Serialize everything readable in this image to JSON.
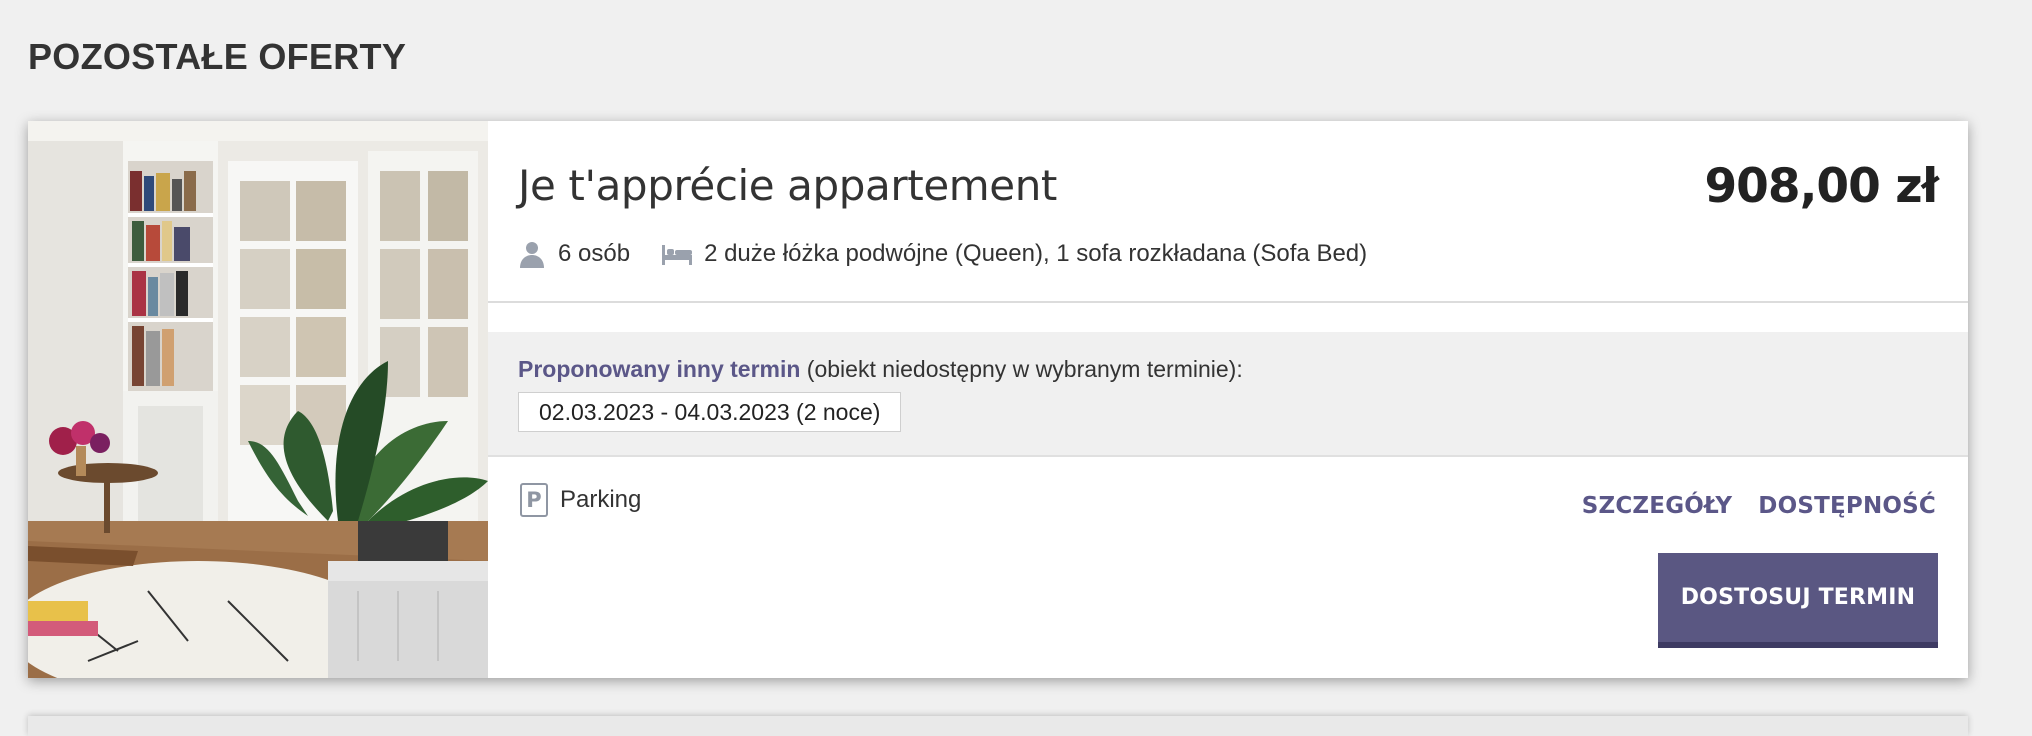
{
  "section": {
    "title": "POZOSTAŁE OFERTY"
  },
  "offer": {
    "title": "Je t'apprécie appartement",
    "price": "908,00 zł",
    "guests": "6 osób",
    "beds": "2 duże łóżka podwójne (Queen), 1 sofa rozkładana (Sofa Bed)",
    "guests_icon": "person-icon",
    "beds_icon": "bed-icon",
    "alternative": {
      "label_accent": "Proponowany inny termin",
      "label_rest": " (obiekt niedostępny w wybranym terminie):",
      "dates": "02.03.2023 - 04.03.2023 (2 noce)"
    },
    "amenities": [
      {
        "icon": "parking-icon",
        "icon_letter": "P",
        "label": "Parking"
      }
    ],
    "links": {
      "details": "SZCZEGÓŁY",
      "availability": "DOSTĘPNOŚĆ"
    },
    "cta_label": "DOSTOSUJ TERMIN"
  },
  "colors": {
    "accent": "#5b5788",
    "button_bg": "#5a5782",
    "page_bg": "#f0f0f0"
  }
}
